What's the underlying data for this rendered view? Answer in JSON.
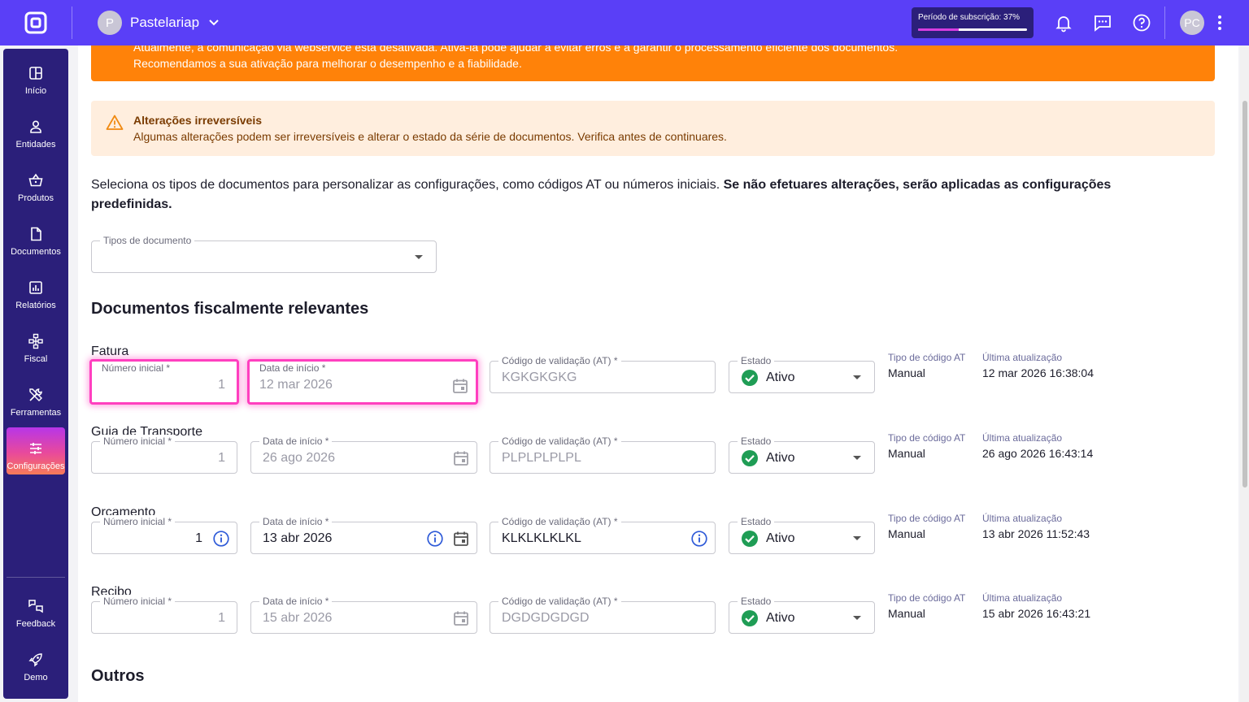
{
  "topbar": {
    "company_initial": "P",
    "company_name": "Pastelariap",
    "subscription_label": "Período de subscrição: 37%",
    "subscription_progress": 0.37,
    "user_initials": "PC"
  },
  "sidebar": {
    "items": [
      {
        "label": "Início",
        "icon": "dashboard-icon"
      },
      {
        "label": "Entidades",
        "icon": "person-icon"
      },
      {
        "label": "Produtos",
        "icon": "basket-icon"
      },
      {
        "label": "Documentos",
        "icon": "document-icon"
      },
      {
        "label": "Relatórios",
        "icon": "report-icon"
      },
      {
        "label": "Fiscal",
        "icon": "network-icon"
      },
      {
        "label": "Ferramentas",
        "icon": "tools-icon"
      },
      {
        "label": "Configurações",
        "icon": "sliders-icon"
      }
    ],
    "bottom": [
      {
        "label": "Feedback",
        "icon": "feedback-icon"
      },
      {
        "label": "Demo",
        "icon": "rocket-icon"
      }
    ]
  },
  "banner": {
    "line1": "Atualmente, a comunicação via webservice está desativada. Ativá-la pode ajudar a evitar erros e a garantir o processamento eficiente dos documentos.",
    "line2": "Recomendamos a sua ativação para melhorar o desempenho e a fiabilidade."
  },
  "warning": {
    "title": "Alterações irreversíveis",
    "text": "Algumas alterações podem ser irreversíveis e alterar o estado da série de documentos. Verifica antes de continuares."
  },
  "intro": {
    "normal": "Seleciona os tipos de documentos para personalizar as configurações, como códigos AT ou números iniciais. ",
    "bold": "Se não efetuares alterações, serão aplicadas as configurações predefinidas."
  },
  "doc_types_select": {
    "label": "Tipos de documento",
    "value": ""
  },
  "section_fiscal": "Documentos fiscalmente relevantes",
  "section_outros": "Outros",
  "labels": {
    "numero_inicial": "Número inicial *",
    "data_inicio": "Data de início *",
    "codigo_validacao": "Código de validação (AT) *",
    "estado": "Estado",
    "tipo_codigo": "Tipo de código AT",
    "ultima_atualizacao": "Última atualização"
  },
  "documents": [
    {
      "name": "Fatura",
      "numero": "1",
      "data": "12 mar 2026",
      "codigo": "KGKGKGKG",
      "estado": "Ativo",
      "tipo": "Manual",
      "atualizacao": "12 mar 2026 16:38:04"
    },
    {
      "name": "Guia de Transporte",
      "numero": "1",
      "data": "26 ago 2026",
      "codigo": "PLPLPLPLPL",
      "estado": "Ativo",
      "tipo": "Manual",
      "atualizacao": "26 ago 2026 16:43:14"
    },
    {
      "name": "Orçamento",
      "numero": "1",
      "data": "13 abr 2026",
      "codigo": "KLKLKLKLKL",
      "estado": "Ativo",
      "tipo": "Manual",
      "atualizacao": "13 abr 2026 11:52:43"
    },
    {
      "name": "Recibo",
      "numero": "1",
      "data": "15 abr 2026",
      "codigo": "DGDGDGDGD",
      "estado": "Ativo",
      "tipo": "Manual",
      "atualizacao": "15 abr 2026 16:43:21"
    }
  ],
  "colors": {
    "brand": "#5a3ff7",
    "sidebar": "#2b1f7a",
    "banner": "#ff8209",
    "warning_bg": "#ffeede",
    "highlight": "#ff3fbf",
    "active_green": "#1f9d55",
    "info_blue": "#2f5bd8"
  }
}
